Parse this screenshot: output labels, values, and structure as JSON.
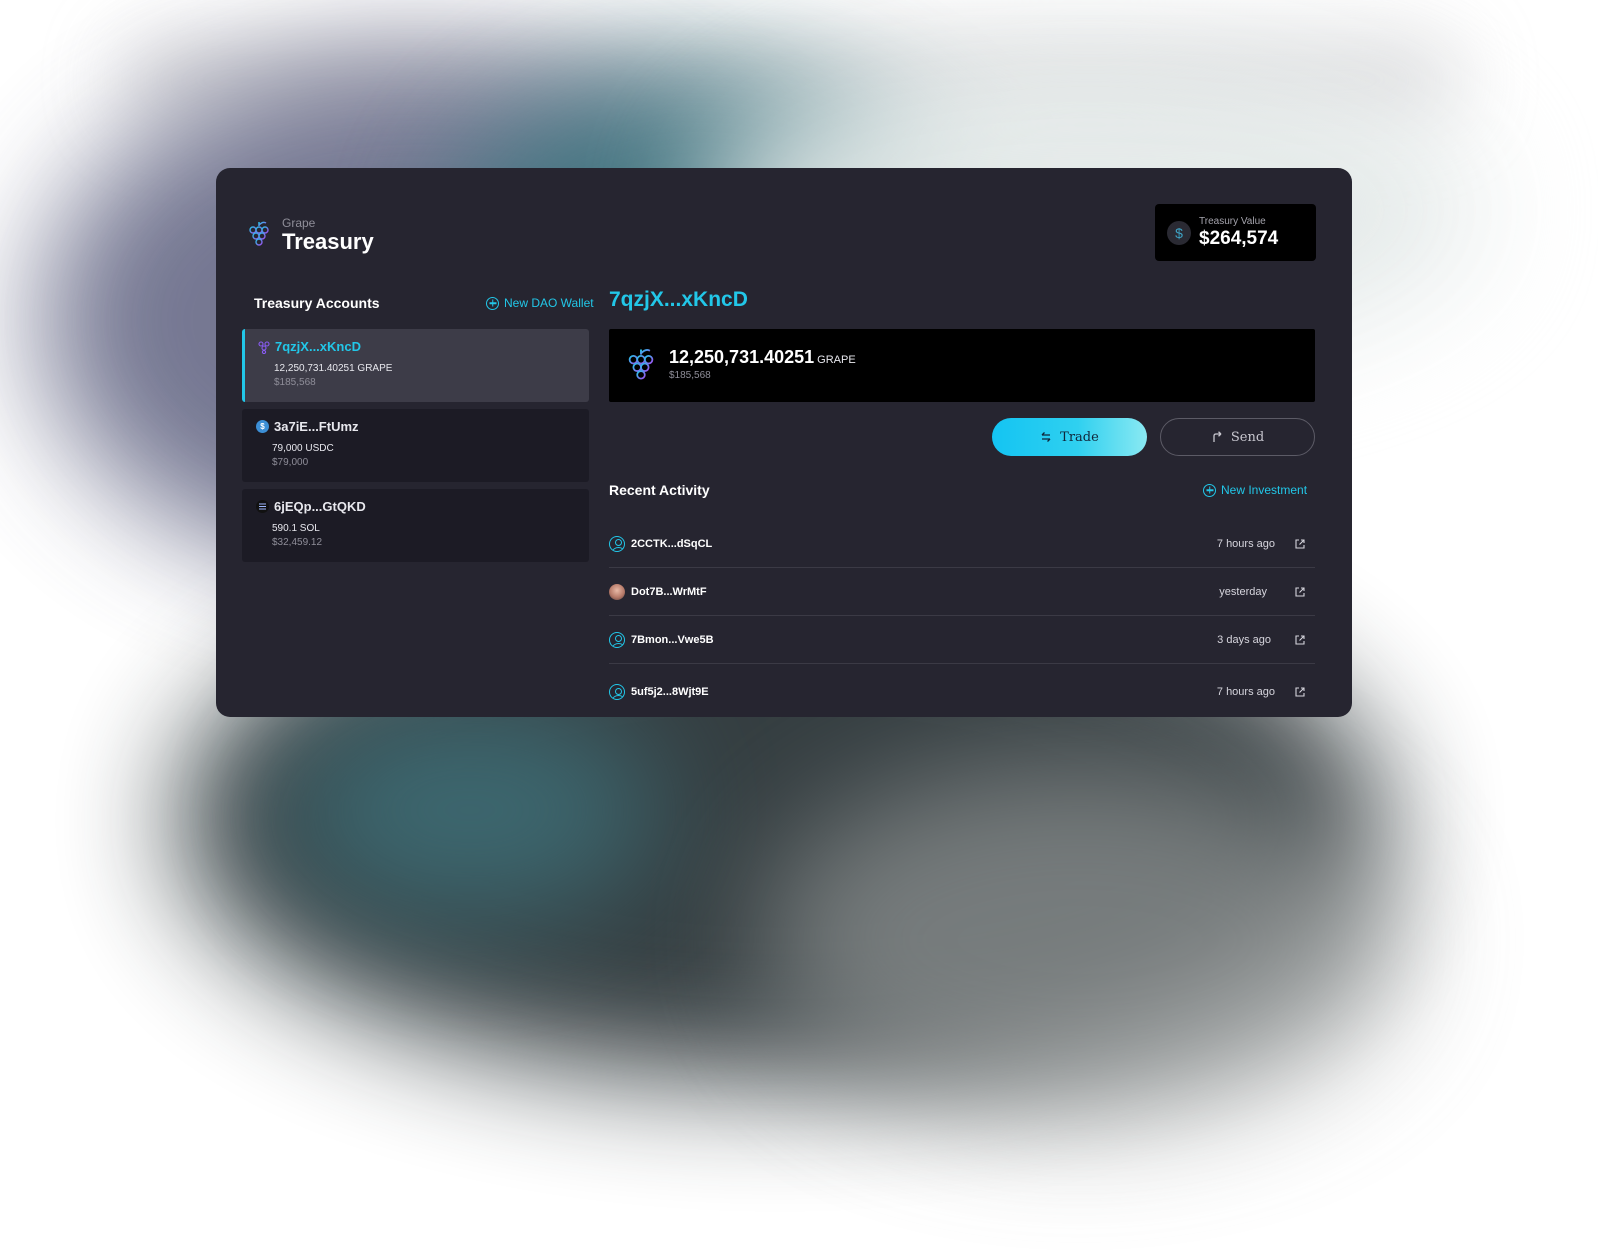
{
  "brand": {
    "small": "Grape",
    "big": "Treasury"
  },
  "treasury_value": {
    "label": "Treasury Value",
    "value": "$264,574",
    "icon": "dollar-icon",
    "glyph": "$"
  },
  "accounts_section": {
    "title": "Treasury Accounts",
    "new_wallet_label": "New DAO Wallet"
  },
  "accounts": [
    {
      "name": "7qzjX...xKncD",
      "amount": "12,250,731.40251 GRAPE",
      "usd": "$185,568",
      "icon": "grape-icon",
      "active": true
    },
    {
      "name": "3a7iE...FtUmz",
      "amount": "79,000 USDC",
      "usd": "$79,000",
      "icon": "usdc-icon",
      "glyph": "$",
      "active": false
    },
    {
      "name": "6jEQp...GtQKD",
      "amount": "590.1 SOL",
      "usd": "$32,459.12",
      "icon": "solana-icon",
      "active": false
    }
  ],
  "selected": {
    "address": "7qzjX...xKncD",
    "balance": "12,250,731.40251",
    "token": "GRAPE",
    "usd": "$185,568"
  },
  "actions": {
    "trade": "Trade",
    "send": "Send"
  },
  "recent": {
    "title": "Recent Activity",
    "new_investment_label": "New Investment",
    "rows": [
      {
        "user": "2CCTK...dSqCL",
        "time": "7 hours ago",
        "avatar": "user-icon"
      },
      {
        "user": "Dot7B...WrMtF",
        "time": "yesterday",
        "avatar": "photo-avatar"
      },
      {
        "user": "7Bmon...Vwe5B",
        "time": "3 days ago",
        "avatar": "user-icon"
      },
      {
        "user": "5uf5j2...8Wjt9E",
        "time": "7 hours ago",
        "avatar": "user-icon"
      }
    ]
  },
  "colors": {
    "accent": "#22c7e8",
    "panel": "#262530",
    "card": "#1c1b25",
    "grape_purple": "#8a5cf5"
  }
}
